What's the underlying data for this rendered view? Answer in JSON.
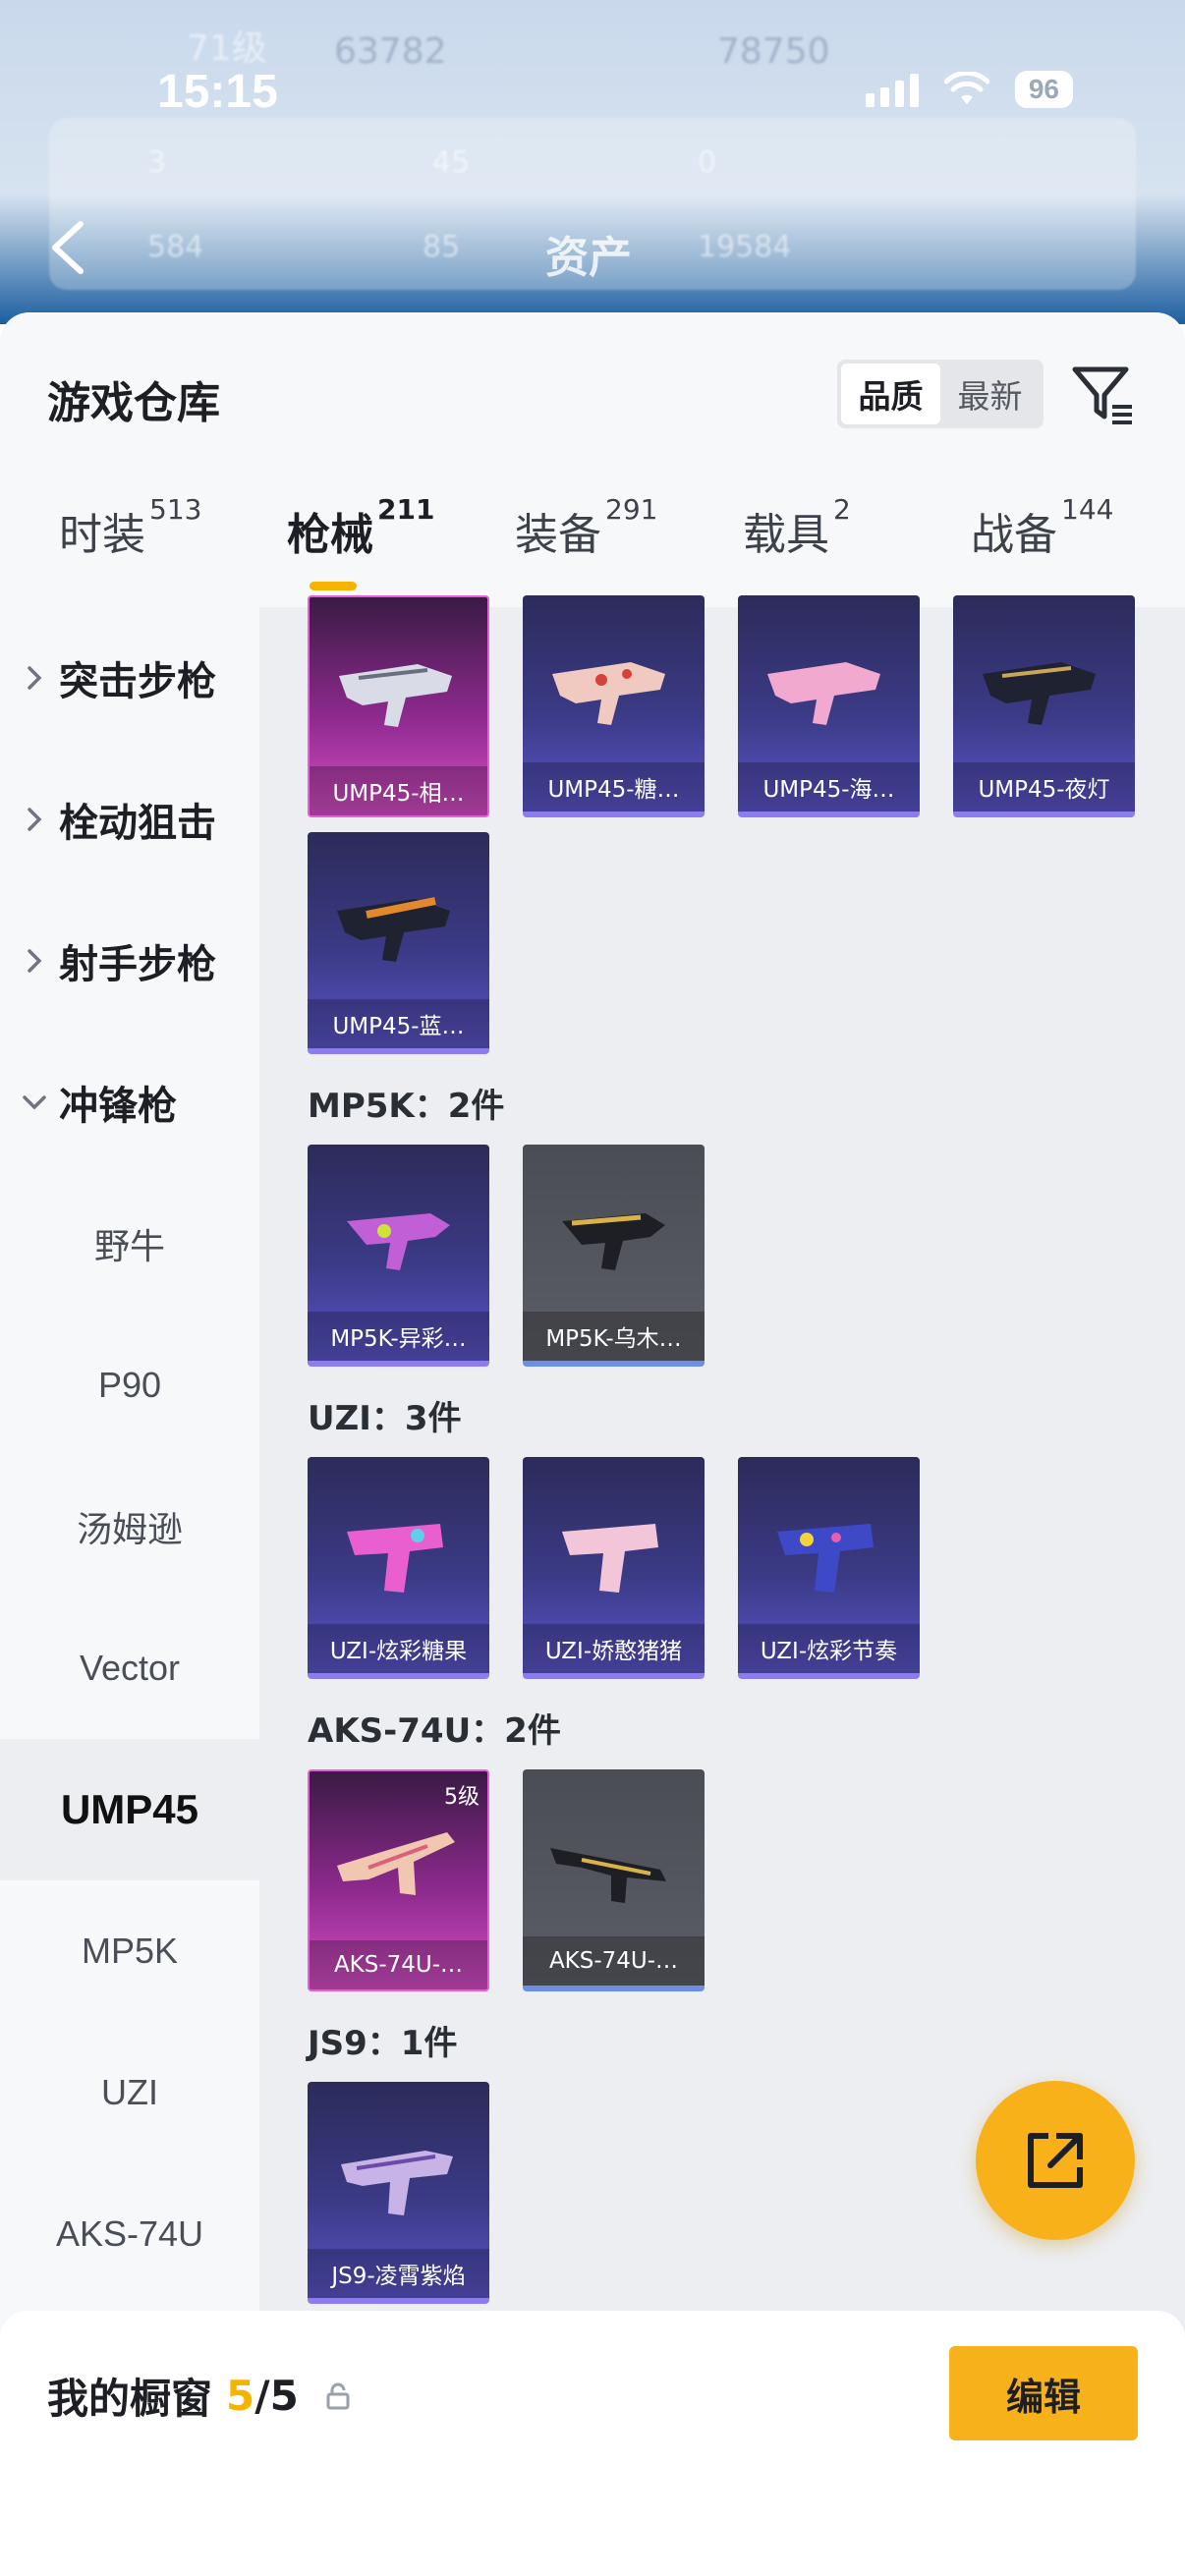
{
  "status_bar": {
    "time": "15:15",
    "battery": "96"
  },
  "background": {
    "ghost_texts": [
      "71级",
      "63782",
      "78750",
      "3",
      "45",
      "0",
      "584",
      "85",
      "19584"
    ]
  },
  "header": {
    "title": "资产"
  },
  "warehouse": {
    "title": "游戏仓库",
    "sort_options": [
      "品质",
      "最新"
    ],
    "sort_selected": "品质"
  },
  "tabs": [
    {
      "label": "时装",
      "count": "513"
    },
    {
      "label": "枪械",
      "count": "211"
    },
    {
      "label": "装备",
      "count": "291"
    },
    {
      "label": "载具",
      "count": "2"
    },
    {
      "label": "战备",
      "count": "144"
    }
  ],
  "active_tab": "枪械",
  "sidebar": {
    "categories": [
      {
        "label": "突击步枪",
        "expanded": false
      },
      {
        "label": "栓动狙击",
        "expanded": false
      },
      {
        "label": "射手步枪",
        "expanded": false
      },
      {
        "label": "冲锋枪",
        "expanded": true
      }
    ],
    "subcategories": [
      "野牛",
      "P90",
      "汤姆逊",
      "Vector",
      "UMP45",
      "MP5K",
      "UZI",
      "AKS-74U"
    ],
    "active_subcategory": "UMP45"
  },
  "groups": [
    {
      "label": "",
      "items": [
        {
          "name": "UMP45-相…",
          "rarity": "pink"
        },
        {
          "name": "UMP45-糖…",
          "rarity": "purple"
        },
        {
          "name": "UMP45-海…",
          "rarity": "purple"
        },
        {
          "name": "UMP45-夜灯",
          "rarity": "purple"
        },
        {
          "name": "UMP45-蓝…",
          "rarity": "purple"
        }
      ]
    },
    {
      "label": "MP5K：2件",
      "items": [
        {
          "name": "MP5K-异彩…",
          "rarity": "purple"
        },
        {
          "name": "MP5K-乌木…",
          "rarity": "gray"
        }
      ]
    },
    {
      "label": "UZI：3件",
      "items": [
        {
          "name": "UZI-炫彩糖果",
          "rarity": "purple"
        },
        {
          "name": "UZI-娇憨猪猪",
          "rarity": "purple"
        },
        {
          "name": "UZI-炫彩节奏",
          "rarity": "purple"
        }
      ]
    },
    {
      "label": "AKS-74U：2件",
      "items": [
        {
          "name": "AKS-74U-…",
          "rarity": "pink",
          "level": "5级"
        },
        {
          "name": "AKS-74U-…",
          "rarity": "gray"
        }
      ]
    },
    {
      "label": "JS9：1件",
      "items": [
        {
          "name": "JS9-凌霄紫焰",
          "rarity": "purple"
        }
      ]
    }
  ],
  "showcase": {
    "title": "我的橱窗",
    "count": "5",
    "total": "/5",
    "edit_label": "编辑"
  },
  "colors": {
    "accent": "#f5b400",
    "button": "#f7b21b",
    "purple_rarity": "#3b3a86",
    "pink_rarity": "#d64ec7",
    "gray_rarity": "#5b5e66"
  }
}
